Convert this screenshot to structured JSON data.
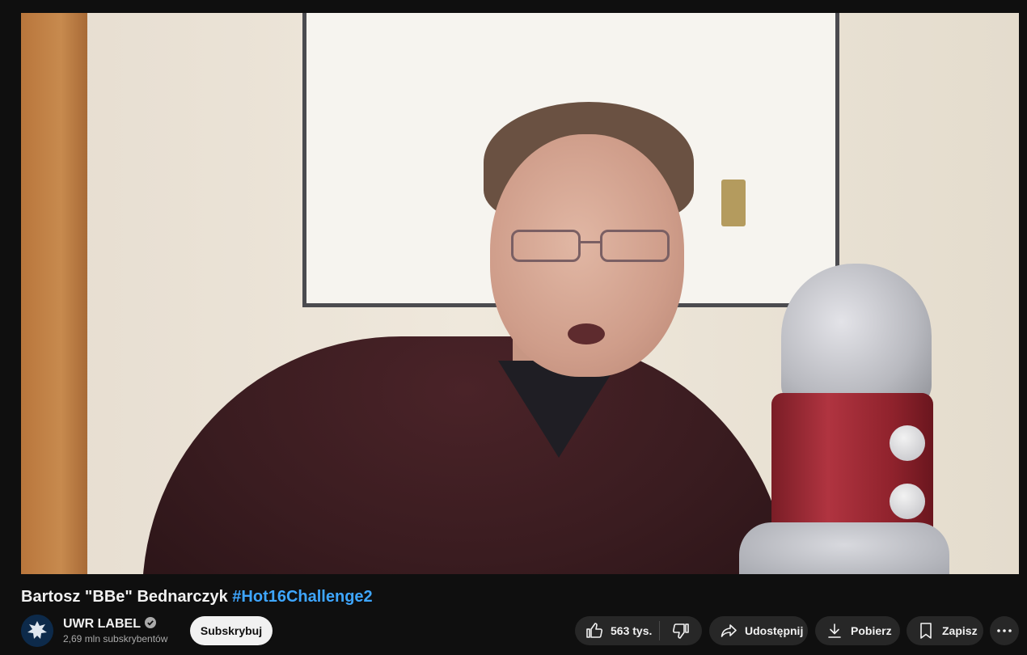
{
  "video": {
    "title_main": "Bartosz \"BBe\" Bednarczyk",
    "title_hashtag": "#Hot16Challenge2"
  },
  "channel": {
    "name": "UWR LABEL",
    "subscribers": "2,69 mln subskrybentów",
    "verified": true
  },
  "actions": {
    "subscribe_label": "Subskrybuj",
    "like_count": "563 tys.",
    "share_label": "Udostępnij",
    "download_label": "Pobierz",
    "save_label": "Zapisz"
  },
  "icons": {
    "like": "thumbs-up-icon",
    "dislike": "thumbs-down-icon",
    "share": "share-arrow-icon",
    "download": "download-icon",
    "save": "bookmark-icon",
    "more": "more-dots-icon",
    "verified": "verified-check-icon"
  },
  "colors": {
    "background": "#0f0f0f",
    "button": "#272727",
    "hashtag": "#3ea6ff",
    "subscribe_bg": "#f1f1f1"
  }
}
